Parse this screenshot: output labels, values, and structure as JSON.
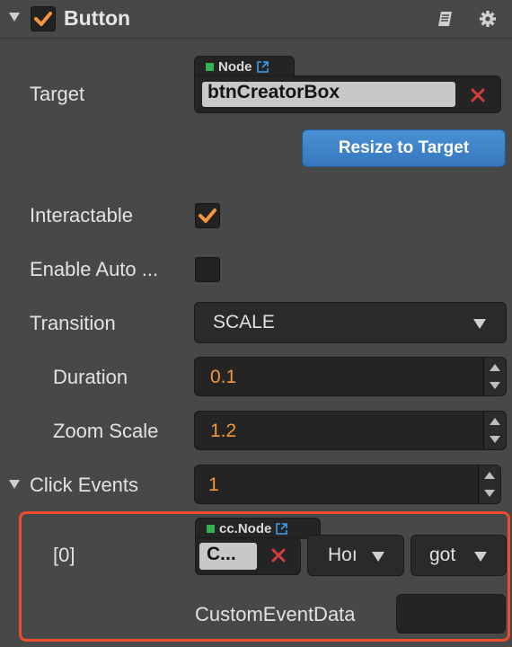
{
  "header": {
    "title": "Button",
    "enabled": true,
    "icons": [
      "book-icon",
      "gear-icon"
    ]
  },
  "target": {
    "label": "Target",
    "node_type": "Node",
    "node_name": "btnCreatorBox",
    "resize_button": "Resize to Target"
  },
  "interactable": {
    "label": "Interactable",
    "checked": true
  },
  "enable_auto": {
    "label": "Enable Auto ...",
    "checked": false
  },
  "transition": {
    "label": "Transition",
    "value": "SCALE"
  },
  "duration": {
    "label": "Duration",
    "value": "0.1"
  },
  "zoom_scale": {
    "label": "Zoom Scale",
    "value": "1.2"
  },
  "click_events": {
    "label": "Click Events",
    "count": "1",
    "items": [
      {
        "index_label": "[0]",
        "node_type": "cc.Node",
        "node_name": "C...",
        "component": "Hoı",
        "handler": "got",
        "custom_event_label": "CustomEventData",
        "custom_event_value": ""
      }
    ]
  },
  "colors": {
    "accent_orange": "#f5963c",
    "button_blue": "#3d82c8",
    "highlight_red": "#ee4d2d",
    "clear_red": "#d33c3c"
  }
}
